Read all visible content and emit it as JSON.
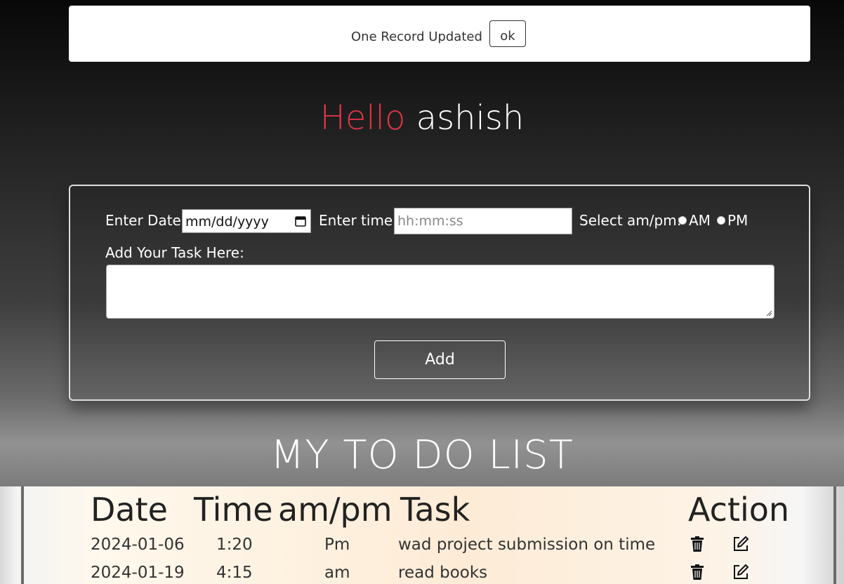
{
  "toast": {
    "message": "One Record Updated",
    "ok_label": "ok"
  },
  "greeting": {
    "hello": "Hello",
    "name": "ashish",
    "hello_color": "#dc3545"
  },
  "form": {
    "date_label": "Enter Date:",
    "date_placeholder": "mm/dd/yyyy",
    "time_label": "Enter time:",
    "time_placeholder": "hh:mm:ss",
    "ampm_label": "Select am/pm:",
    "am_label": "AM",
    "pm_label": "PM",
    "task_label": "Add Your Task Here:",
    "task_value": "",
    "add_label": "Add"
  },
  "list": {
    "title": "MY TO DO LIST",
    "headers": {
      "date": "Date",
      "time": "Time",
      "ampm": "am/pm",
      "task": "Task",
      "action": "Action"
    },
    "rows": [
      {
        "date": "2024-01-06",
        "time": "1:20",
        "ampm": "Pm",
        "task": "wad project submission on time"
      },
      {
        "date": "2024-01-19",
        "time": "4:15",
        "ampm": "am",
        "task": "read books"
      }
    ]
  },
  "icons": {
    "delete": "trash-icon",
    "edit": "edit-icon",
    "calendar": "calendar-icon"
  }
}
